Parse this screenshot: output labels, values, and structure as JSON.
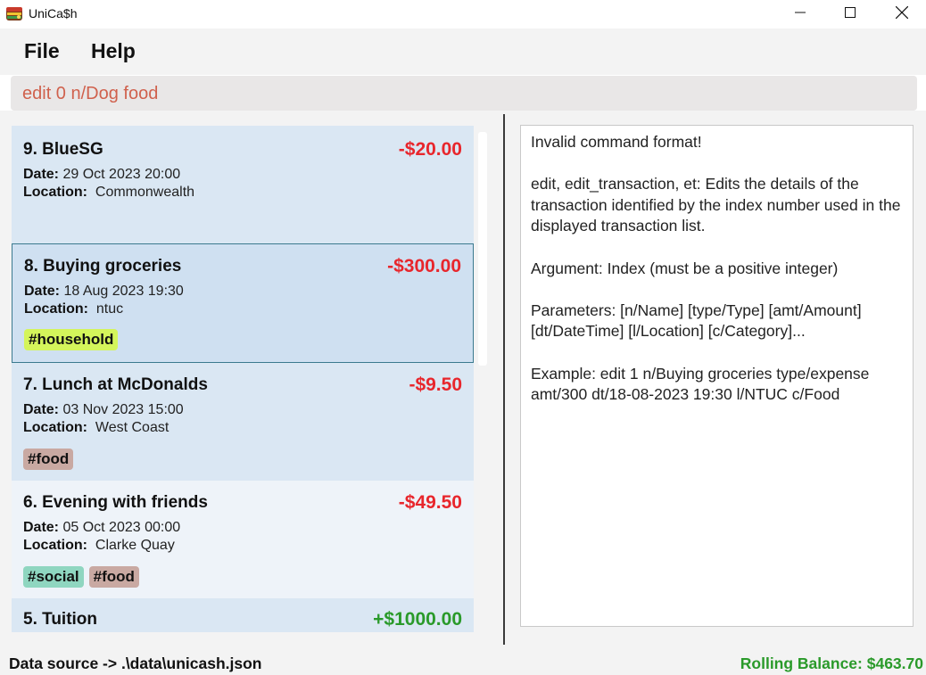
{
  "window": {
    "title": "UniCa$h",
    "minimize_icon": "minimize-icon",
    "maximize_icon": "maximize-icon",
    "close_icon": "close-icon"
  },
  "menu": {
    "file": "File",
    "help": "Help"
  },
  "command": {
    "value": "edit 0 n/Dog food",
    "color": "#d0614d"
  },
  "transactions": [
    {
      "title": "9. BlueSG",
      "amount": "-$20.00",
      "date_label": "Date:",
      "date": "29 Oct 2023 20:00",
      "location_label": "Location:",
      "location": "Commonwealth",
      "tags": []
    },
    {
      "title": "8. Buying groceries",
      "amount": "-$300.00",
      "date_label": "Date:",
      "date": "18 Aug 2023 19:30",
      "location_label": "Location:",
      "location": "ntuc",
      "tags": [
        {
          "label": "#household",
          "color": "#d4f55b"
        }
      ]
    },
    {
      "title": "7. Lunch at McDonalds",
      "amount": "-$9.50",
      "date_label": "Date:",
      "date": "03 Nov 2023 15:00",
      "location_label": "Location:",
      "location": "West Coast",
      "tags": [
        {
          "label": "#food",
          "color": "#c9a9a2"
        }
      ]
    },
    {
      "title": "6. Evening with friends",
      "amount": "-$49.50",
      "date_label": "Date:",
      "date": "05 Oct 2023 00:00",
      "location_label": "Location:",
      "location": "Clarke Quay",
      "tags": [
        {
          "label": "#social",
          "color": "#8fd6c0"
        },
        {
          "label": "#food",
          "color": "#c9a9a2"
        }
      ]
    },
    {
      "title": "5. Tuition",
      "amount": "+$1000.00",
      "tags": []
    }
  ],
  "result": {
    "text": "Invalid command format!\n\nedit, edit_transaction, et: Edits the details of the transaction identified by the index number used in the displayed transaction list.\n\nArgument: Index (must be a positive integer)\n\nParameters: [n/Name] [type/Type] [amt/Amount] [dt/DateTime] [l/Location] [c/Category]...\n\nExample: edit 1 n/Buying groceries type/expense amt/300 dt/18-08-2023 19:30 l/NTUC c/Food"
  },
  "status": {
    "data_source": "Data source -> .\\data\\unicash.json",
    "rolling_balance": "Rolling Balance: $463.70"
  },
  "colors": {
    "negative": "#e8262c",
    "positive": "#2a9a2a",
    "card_bg": "#dae7f3",
    "selected_card_bg": "#cfe0f1"
  }
}
